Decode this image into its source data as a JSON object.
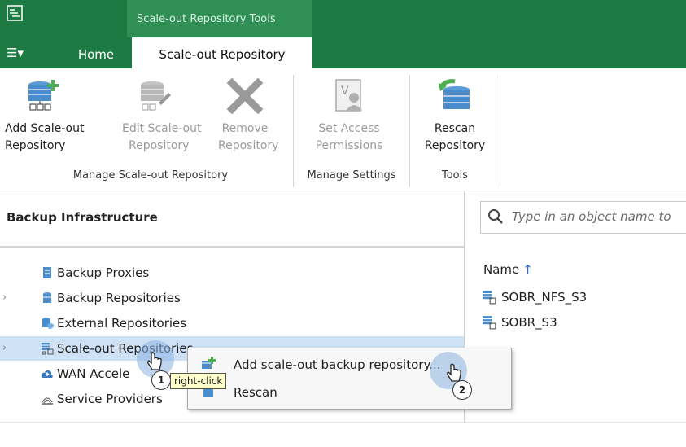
{
  "window": {
    "context_tab_group": "Scale-out Repository Tools",
    "tabs": [
      "Home",
      "Scale-out Repository"
    ],
    "menu_icon": "hamburger-menu-icon"
  },
  "ribbon": {
    "buttons": [
      {
        "line1": "Add Scale-out",
        "line2": "Repository",
        "icon": "add-repository-icon",
        "enabled": true
      },
      {
        "line1": "Edit Scale-out",
        "line2": "Repository",
        "icon": "edit-repository-icon",
        "enabled": false
      },
      {
        "line1": "Remove",
        "line2": "Repository",
        "icon": "remove-x-icon",
        "enabled": false
      },
      {
        "line1": "Set Access",
        "line2": "Permissions",
        "icon": "permissions-icon",
        "enabled": false
      },
      {
        "line1": "Rescan",
        "line2": "Repository",
        "icon": "rescan-icon",
        "enabled": true
      }
    ],
    "groups": [
      "Manage Scale-out Repository",
      "Manage Settings",
      "Tools"
    ]
  },
  "navigation": {
    "title": "Backup Infrastructure",
    "items": [
      {
        "label": "Backup Proxies",
        "icon": "proxy-icon"
      },
      {
        "label": "Backup Repositories",
        "icon": "repository-icon"
      },
      {
        "label": "External Repositories",
        "icon": "external-repository-icon"
      },
      {
        "label": "Scale-out Repositories",
        "icon": "scaleout-repository-icon"
      },
      {
        "label": "WAN Accele",
        "icon": "wan-cloud-icon"
      },
      {
        "label": "Service Providers",
        "icon": "service-provider-icon"
      }
    ]
  },
  "content": {
    "search_placeholder": "Type in an object name to",
    "column_name": "Name",
    "repositories": [
      "SOBR_NFS_S3",
      "SOBR_S3"
    ]
  },
  "context_menu": {
    "items": [
      "Add scale-out backup repository...",
      "Rescan"
    ]
  },
  "annotations": {
    "tooltip": "right-click",
    "step1": "1",
    "step2": "2"
  },
  "colors": {
    "accent_green": "#1d7a43",
    "selection_blue": "#cfe1f5"
  }
}
